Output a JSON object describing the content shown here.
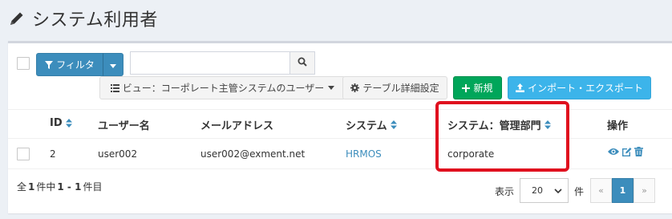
{
  "page": {
    "title": "システム利用者",
    "title_icon": "pencil-icon"
  },
  "toolbar": {
    "filter_label": "フィルタ",
    "search_value": "",
    "search_placeholder": "",
    "view_label": "ビュー：コーポレート主管システムのユーザー",
    "table_settings_label": "テーブル詳細設定",
    "new_label": "新規",
    "import_export_label": "インポート・エクスポート"
  },
  "table": {
    "columns": {
      "id": "ID",
      "user": "ユーザー名",
      "email": "メールアドレス",
      "system": "システム",
      "system_dept": "システム：管理部門",
      "actions": "操作"
    },
    "rows": [
      {
        "id": "2",
        "user": "user002",
        "email": "user002@exment.net",
        "system": "HRMOS",
        "system_dept": "corporate"
      }
    ]
  },
  "footer": {
    "summary_prefix": "全",
    "total": "1",
    "summary_mid1": "件中",
    "range": "1 - 1",
    "summary_suffix": "件目",
    "display_label": "表示",
    "per_page": "20",
    "per_page_unit": "件",
    "prev": "«",
    "current_page": "1",
    "next": "»"
  },
  "colors": {
    "primary": "#3c8dbc",
    "success": "#00a65a",
    "info": "#3cb4ea",
    "highlight": "#e0101e"
  }
}
